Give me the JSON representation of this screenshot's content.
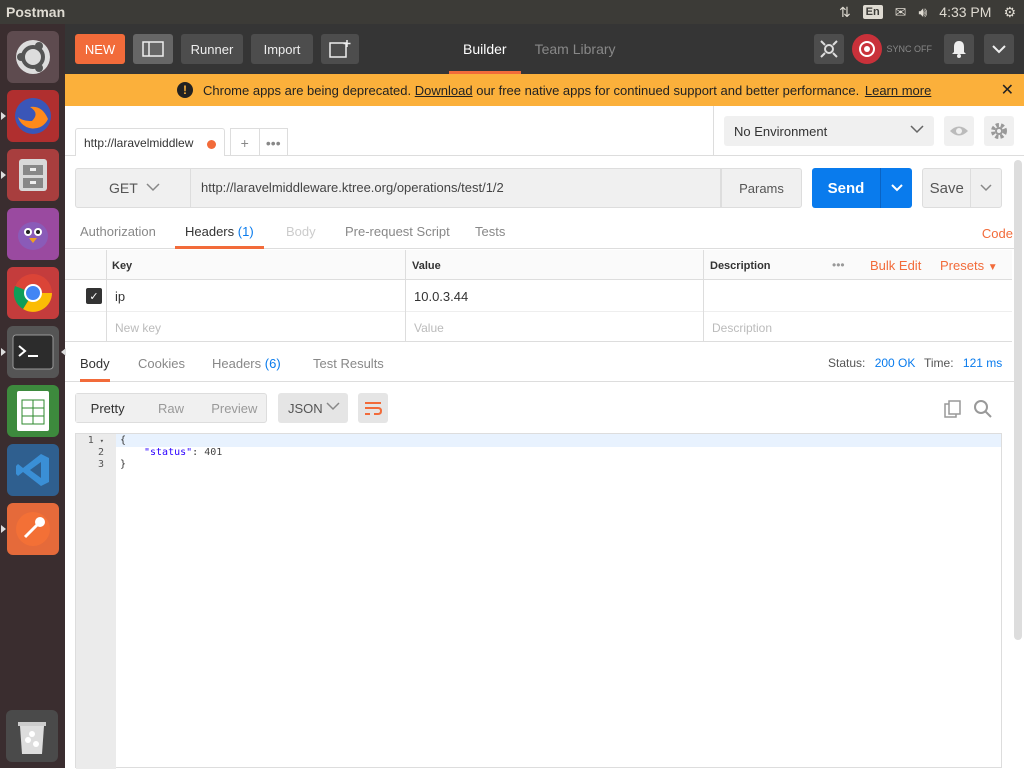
{
  "os": {
    "app_title": "Postman",
    "keyboard_layout": "En",
    "clock": "4:33 PM"
  },
  "launcher": {
    "items": [
      "ubuntu-dash",
      "firefox",
      "file-manager",
      "pidgin",
      "chrome",
      "terminal",
      "libreoffice-calc",
      "vscode",
      "postman",
      "trash"
    ]
  },
  "header": {
    "new_label": "NEW",
    "runner_label": "Runner",
    "import_label": "Import",
    "tabs": [
      {
        "label": "Builder",
        "active": true
      },
      {
        "label": "Team Library",
        "active": false
      }
    ],
    "sync_label": "SYNC OFF"
  },
  "banner": {
    "text_before": "Chrome apps are being deprecated.",
    "download_link": "Download",
    "text_after": "our free native apps for continued support and better performance.",
    "learn_more": "Learn more",
    "close": "✕"
  },
  "request_tab": {
    "label": "http://laravelmiddlew",
    "add": "+",
    "more": "•••"
  },
  "environment": {
    "selected": "No Environment"
  },
  "request": {
    "method": "GET",
    "url": "http://laravelmiddleware.ktree.org/operations/test/1/2",
    "params_label": "Params",
    "send_label": "Send",
    "save_label": "Save"
  },
  "req_tabs": {
    "authorization": "Authorization",
    "headers": "Headers",
    "headers_count": "(1)",
    "body": "Body",
    "prerequest": "Pre-request Script",
    "tests": "Tests",
    "code": "Code"
  },
  "headers_table": {
    "col_key": "Key",
    "col_value": "Value",
    "col_description": "Description",
    "more": "•••",
    "bulk_edit": "Bulk Edit",
    "presets": "Presets",
    "rows": [
      {
        "key": "ip",
        "value": "10.0.3.44",
        "description": "",
        "checked": true
      }
    ],
    "placeholder_key": "New key",
    "placeholder_value": "Value",
    "placeholder_description": "Description"
  },
  "response": {
    "tabs": {
      "body": "Body",
      "cookies": "Cookies",
      "headers": "Headers",
      "headers_count": "(6)",
      "test_results": "Test Results"
    },
    "status_label": "Status:",
    "status_value": "200 OK",
    "time_label": "Time:",
    "time_value": "121 ms",
    "format_tabs": [
      "Pretty",
      "Raw",
      "Preview"
    ],
    "format_selected": "Pretty",
    "language": "JSON",
    "lines": [
      "1",
      "2",
      "3"
    ],
    "line1": "{",
    "line2_key": "\"status\"",
    "line2_sep": ": ",
    "line2_val": "401",
    "line3": "}"
  }
}
